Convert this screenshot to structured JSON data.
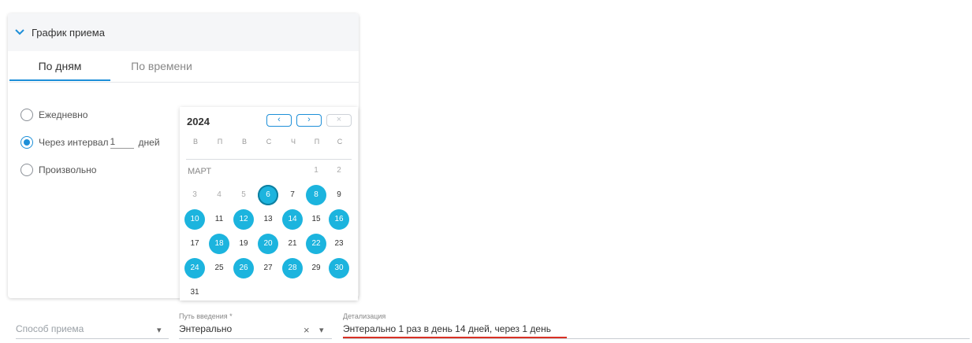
{
  "panel": {
    "title": "График приема"
  },
  "tabs": [
    {
      "label": "По дням"
    },
    {
      "label": "По времени"
    }
  ],
  "radios": [
    {
      "label": "Ежедневно",
      "checked": false
    },
    {
      "label": "Через интервал",
      "value": "1",
      "suffix": "дней",
      "checked": true
    },
    {
      "label": "Произвольно",
      "checked": false
    }
  ],
  "calendar": {
    "year": "2024",
    "month": "МАРТ",
    "weekdays": [
      "В",
      "П",
      "В",
      "С",
      "Ч",
      "П",
      "С"
    ],
    "today": 6,
    "selected_days": [
      6,
      8,
      10,
      12,
      14,
      16,
      18,
      20,
      22,
      24,
      26,
      28,
      30
    ],
    "days": [
      "1",
      "2",
      "3",
      "4",
      "5",
      "6",
      "7",
      "8",
      "9",
      "10",
      "11",
      "12",
      "13",
      "14",
      "15",
      "16",
      "17",
      "18",
      "19",
      "20",
      "21",
      "22",
      "23",
      "24",
      "25",
      "26",
      "27",
      "28",
      "29",
      "30",
      "31"
    ],
    "nav": {
      "prev": "‹",
      "next": "›",
      "close": "×"
    }
  },
  "fields": {
    "method": {
      "placeholder": "Способ приема"
    },
    "route": {
      "label": "Путь введения *",
      "value": "Энтерально"
    },
    "detail": {
      "label": "Детализация",
      "value": "Энтерально 1 раз в день 14 дней, через  1 день"
    }
  },
  "colors": {
    "accent": "#1d8fd8",
    "selected_day": "#1cb4de",
    "error_underline": "#d93025"
  }
}
